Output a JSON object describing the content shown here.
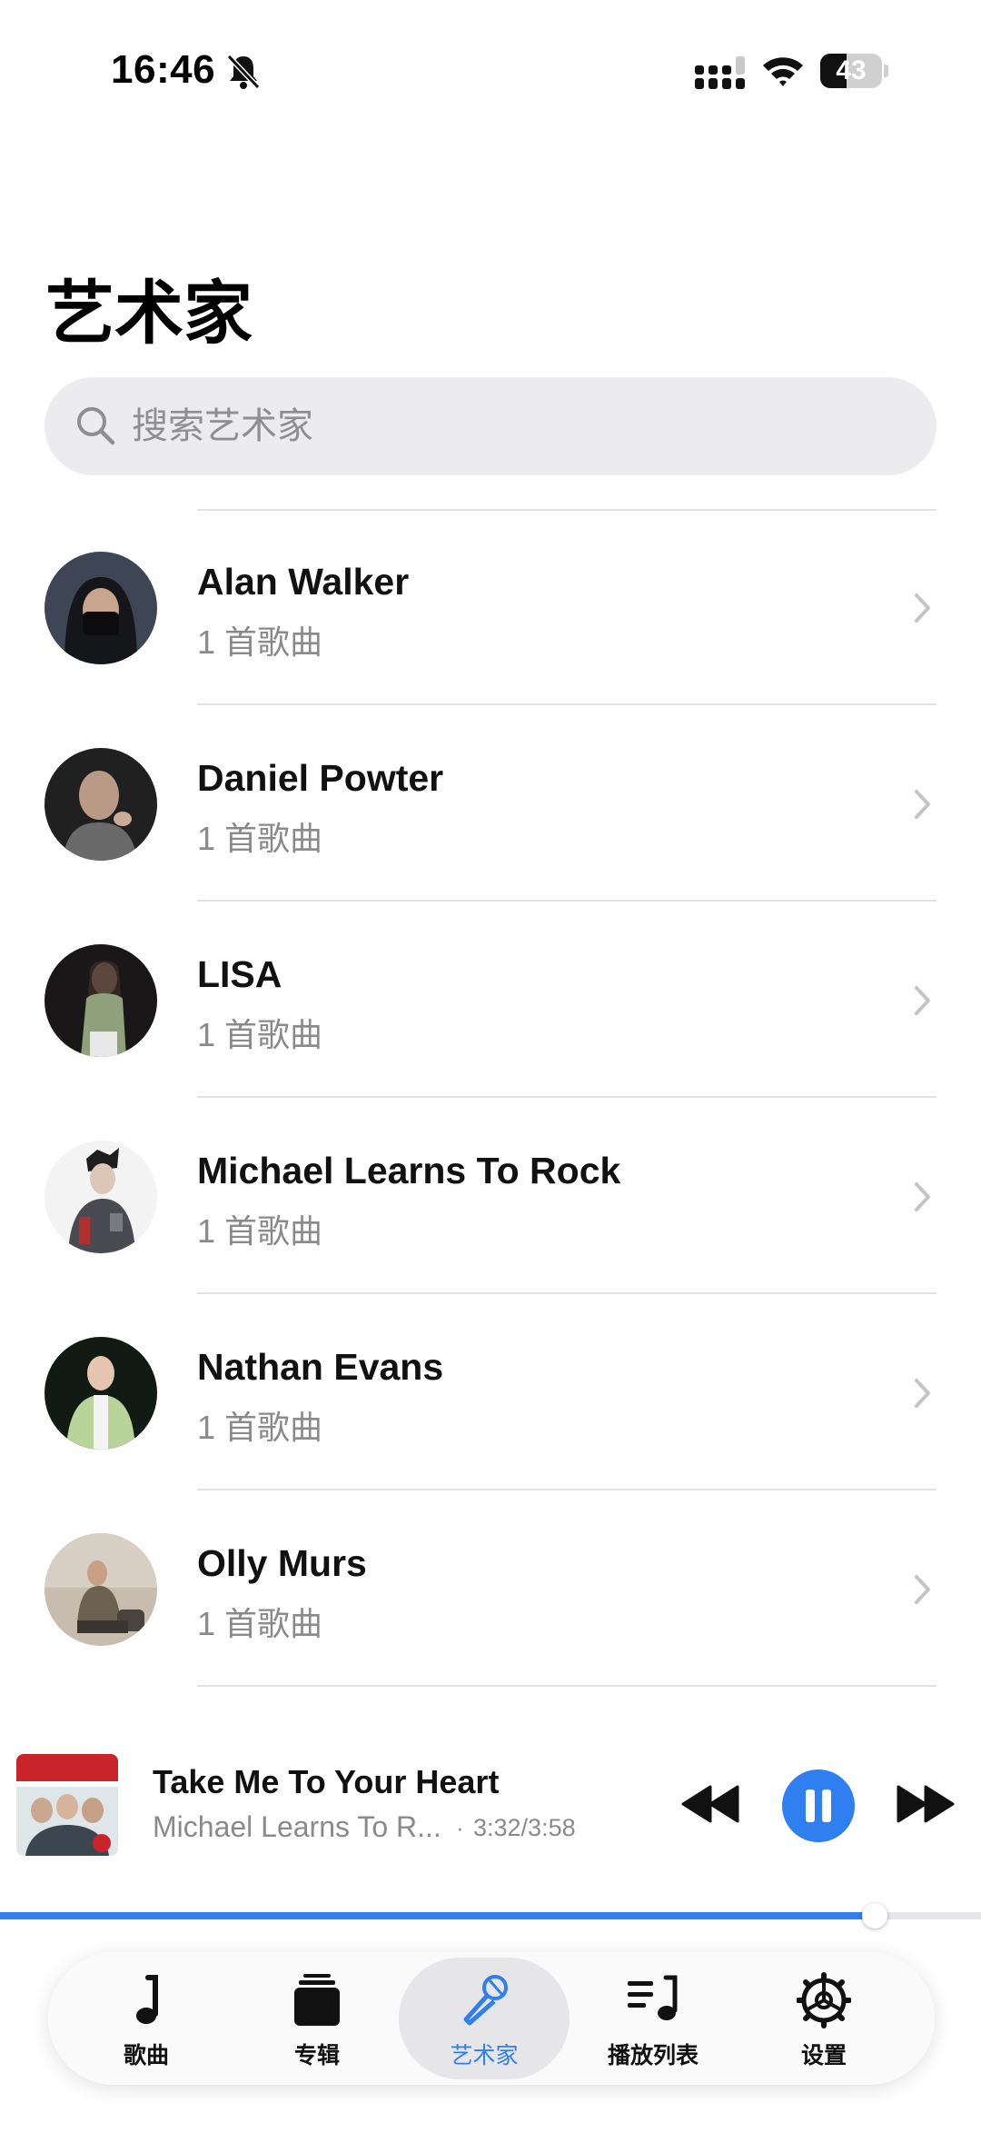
{
  "status_bar": {
    "time": "16:46",
    "battery": "43",
    "battery_level": 0.43,
    "icons": [
      "bell-slash-icon",
      "signal-icon",
      "wifi-icon",
      "battery-icon"
    ]
  },
  "page": {
    "title": "艺术家",
    "search": {
      "placeholder": "搜索艺术家",
      "value": ""
    }
  },
  "artists": [
    {
      "name": "Alan Walker",
      "count": "1 首歌曲"
    },
    {
      "name": "Daniel Powter",
      "count": "1 首歌曲"
    },
    {
      "name": "LISA",
      "count": "1 首歌曲"
    },
    {
      "name": "Michael Learns To Rock",
      "count": "1 首歌曲"
    },
    {
      "name": "Nathan Evans",
      "count": "1 首歌曲"
    },
    {
      "name": "Olly Murs",
      "count": "1 首歌曲"
    }
  ],
  "now_playing": {
    "title": "Take Me To Your Heart",
    "artist": "Michael Learns To R...",
    "separator": "·",
    "time": "3:32/3:58",
    "progress": 0.892,
    "state": "playing"
  },
  "tabs": [
    {
      "label": "歌曲",
      "icon": "music-note-icon",
      "active": false
    },
    {
      "label": "专辑",
      "icon": "album-stack-icon",
      "active": false
    },
    {
      "label": "艺术家",
      "icon": "microphone-icon",
      "active": true
    },
    {
      "label": "播放列表",
      "icon": "playlist-icon",
      "active": false
    },
    {
      "label": "设置",
      "icon": "gear-icon",
      "active": false
    }
  ],
  "colors": {
    "accent": "#2f7ff0",
    "secondary_text": "#8a8a8e",
    "search_bg": "#ececee",
    "divider": "#e3e3e6"
  }
}
